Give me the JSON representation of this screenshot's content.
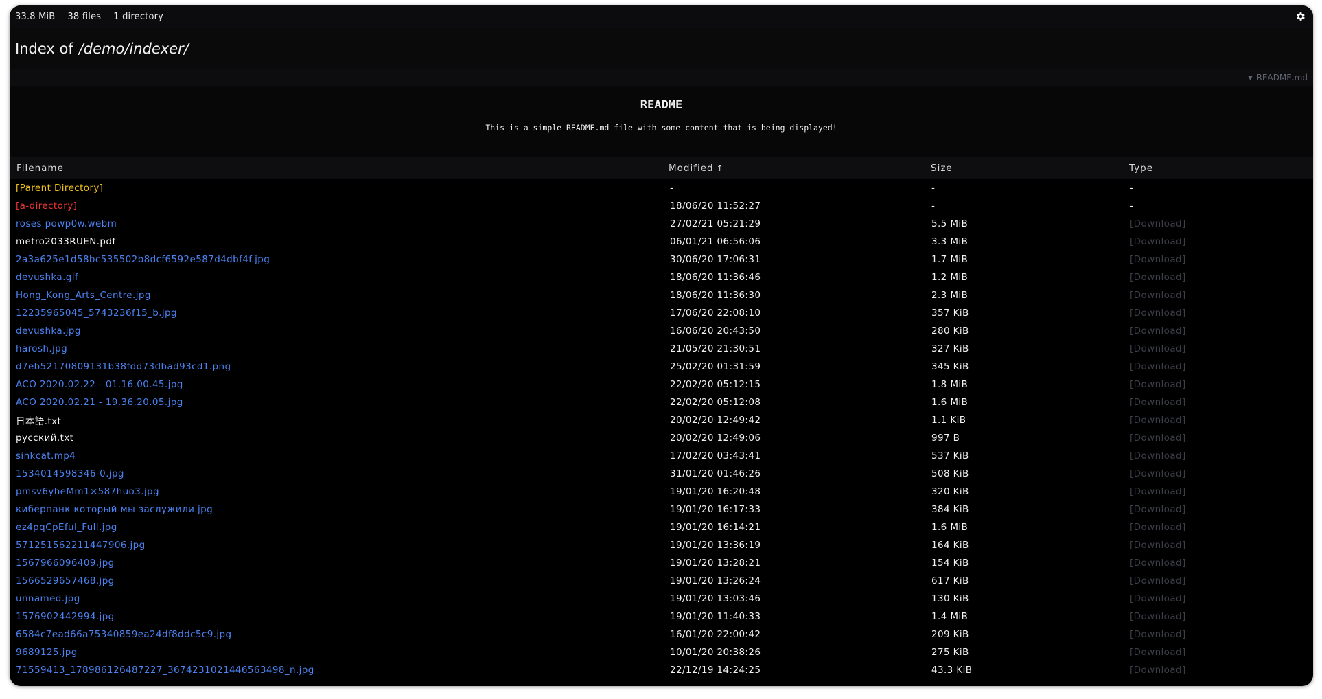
{
  "topbar": {
    "total_size": "33.8 MiB",
    "files_count": "38 files",
    "dirs_count": "1 directory",
    "settings_icon": "gear-icon"
  },
  "header": {
    "title_prefix": "Index of",
    "path": "/demo/indexer/"
  },
  "readme_bar": {
    "toggle_icon": "caret-down-icon",
    "filename": "README.md"
  },
  "readme": {
    "heading": "README",
    "body": "This is a simple README.md file with some content that is being displayed!"
  },
  "table": {
    "columns": {
      "filename": "Filename",
      "modified": "Modified",
      "modified_sort_icon": "arrow-up-icon",
      "size": "Size",
      "type": "Type"
    },
    "rows": [
      {
        "name": "[Parent Directory]",
        "kind": "parent",
        "modified": "-",
        "size": "-",
        "type": "-"
      },
      {
        "name": "[a-directory]",
        "kind": "directory",
        "modified": "18/06/20 11:52:27",
        "size": "-",
        "type": "-"
      },
      {
        "name": "roses powp0w.webm",
        "kind": "file",
        "modified": "27/02/21 05:21:29",
        "size": "5.5 MiB",
        "type": "[Download]"
      },
      {
        "name": "metro2033RUEN.pdf",
        "kind": "file-plain",
        "modified": "06/01/21 06:56:06",
        "size": "3.3 MiB",
        "type": "[Download]"
      },
      {
        "name": "2a3a625e1d58bc535502b8dcf6592e587d4dbf4f.jpg",
        "kind": "file",
        "modified": "30/06/20 17:06:31",
        "size": "1.7 MiB",
        "type": "[Download]"
      },
      {
        "name": "devushka.gif",
        "kind": "file",
        "modified": "18/06/20 11:36:46",
        "size": "1.2 MiB",
        "type": "[Download]"
      },
      {
        "name": "Hong_Kong_Arts_Centre.jpg",
        "kind": "file",
        "modified": "18/06/20 11:36:30",
        "size": "2.3 MiB",
        "type": "[Download]"
      },
      {
        "name": "12235965045_5743236f15_b.jpg",
        "kind": "file",
        "modified": "17/06/20 22:08:10",
        "size": "357 KiB",
        "type": "[Download]"
      },
      {
        "name": "devushka.jpg",
        "kind": "file",
        "modified": "16/06/20 20:43:50",
        "size": "280 KiB",
        "type": "[Download]"
      },
      {
        "name": "harosh.jpg",
        "kind": "file",
        "modified": "21/05/20 21:30:51",
        "size": "327 KiB",
        "type": "[Download]"
      },
      {
        "name": "d7eb52170809131b38fdd73dbad93cd1.png",
        "kind": "file",
        "modified": "25/02/20 01:31:59",
        "size": "345 KiB",
        "type": "[Download]"
      },
      {
        "name": "ACO 2020.02.22 - 01.16.00.45.jpg",
        "kind": "file",
        "modified": "22/02/20 05:12:15",
        "size": "1.8 MiB",
        "type": "[Download]"
      },
      {
        "name": "ACO 2020.02.21 - 19.36.20.05.jpg",
        "kind": "file",
        "modified": "22/02/20 05:12:08",
        "size": "1.6 MiB",
        "type": "[Download]"
      },
      {
        "name": "日本語.txt",
        "kind": "file-plain",
        "modified": "20/02/20 12:49:42",
        "size": "1.1 KiB",
        "type": "[Download]"
      },
      {
        "name": "русский.txt",
        "kind": "file-plain",
        "modified": "20/02/20 12:49:06",
        "size": "997 B",
        "type": "[Download]"
      },
      {
        "name": "sinkcat.mp4",
        "kind": "file",
        "modified": "17/02/20 03:43:41",
        "size": "537 KiB",
        "type": "[Download]"
      },
      {
        "name": "1534014598346-0.jpg",
        "kind": "file",
        "modified": "31/01/20 01:46:26",
        "size": "508 KiB",
        "type": "[Download]"
      },
      {
        "name": "pmsv6yheMm1×587huo3.jpg",
        "kind": "file",
        "modified": "19/01/20 16:20:48",
        "size": "320 KiB",
        "type": "[Download]"
      },
      {
        "name": "киберпанк который мы заслужили.jpg",
        "kind": "file",
        "modified": "19/01/20 16:17:33",
        "size": "384 KiB",
        "type": "[Download]"
      },
      {
        "name": "ez4pqCpEful_Full.jpg",
        "kind": "file",
        "modified": "19/01/20 16:14:21",
        "size": "1.6 MiB",
        "type": "[Download]"
      },
      {
        "name": "571251562211447906.jpg",
        "kind": "file",
        "modified": "19/01/20 13:36:19",
        "size": "164 KiB",
        "type": "[Download]"
      },
      {
        "name": "1567966096409.jpg",
        "kind": "file",
        "modified": "19/01/20 13:28:21",
        "size": "154 KiB",
        "type": "[Download]"
      },
      {
        "name": "1566529657468.jpg",
        "kind": "file",
        "modified": "19/01/20 13:26:24",
        "size": "617 KiB",
        "type": "[Download]"
      },
      {
        "name": "unnamed.jpg",
        "kind": "file",
        "modified": "19/01/20 13:03:46",
        "size": "130 KiB",
        "type": "[Download]"
      },
      {
        "name": "1576902442994.jpg",
        "kind": "file",
        "modified": "19/01/20 11:40:33",
        "size": "1.4 MiB",
        "type": "[Download]"
      },
      {
        "name": "6584c7ead66a75340859ea24df8ddc5c9.jpg",
        "kind": "file",
        "modified": "16/01/20 22:00:42",
        "size": "209 KiB",
        "type": "[Download]"
      },
      {
        "name": "9689125.jpg",
        "kind": "file",
        "modified": "10/01/20 20:38:26",
        "size": "275 KiB",
        "type": "[Download]"
      },
      {
        "name": "71559413_178986126487227_3674231021446563498_n.jpg",
        "kind": "file",
        "modified": "22/12/19 14:24:25",
        "size": "43.3 KiB",
        "type": "[Download]"
      }
    ]
  },
  "colors": {
    "link": "#4b82f0",
    "parent": "#f1c21b",
    "directory": "#ec3434",
    "download": "#3c3f47",
    "background": "#000000"
  }
}
